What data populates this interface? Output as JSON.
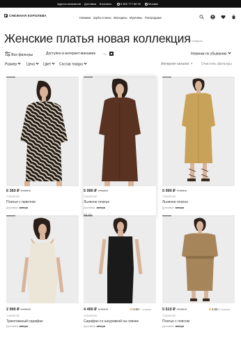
{
  "topbar": {
    "links": [
      "Адреса магазинов",
      "Доставка",
      "Контакты"
    ],
    "phone": "8 800 777 88 99",
    "city": "Москва"
  },
  "header": {
    "logo": "СНЕЖНАЯ КОРОЛЕВА",
    "nav": [
      "Новинки",
      "Шубы и меха",
      "Женщины",
      "Мужчины",
      "Распродажа"
    ],
    "icons": [
      "search-icon",
      "user-icon",
      "heart-icon",
      "cart-icon"
    ]
  },
  "page": {
    "title": "Женские платья новая коллекция",
    "count": "70 товаров"
  },
  "filters": {
    "all_filters": "Все фильтры",
    "online_only": "Доступно в интернет-магазине",
    "online_count": "70",
    "sort": "Новинки по убыванию",
    "size": "Размер",
    "price": "Цена",
    "color": "Цвет",
    "composition": "Состав товара",
    "catalog": "Интернет каталог",
    "clear": "Очистить фильтры"
  },
  "products": [
    {
      "price": "6 360 ₽",
      "old_price": "8 490 ₽",
      "rating": "",
      "reviews": "",
      "brand": "TOM&ROSE",
      "name": "Платье с принтом",
      "delivery_label": "Доставка:",
      "delivery_when": "завтра",
      "sizes": ""
    },
    {
      "price": "5 990 ₽",
      "old_price": "7 990 ₽",
      "rating": "",
      "reviews": "",
      "brand": "TOM&ROSE",
      "name": "Льняное платье",
      "delivery_label": "Доставка:",
      "delivery_when": "завтра",
      "sizes": "XS   XS"
    },
    {
      "price": "5 990 ₽",
      "old_price": "7 990 ₽",
      "rating": "",
      "reviews": "",
      "brand": "TOM&ROSE",
      "name": "Льняное платье",
      "delivery_label": "Доставка:",
      "delivery_when": "завтра",
      "sizes": ""
    },
    {
      "price": "2 990 ₽",
      "old_price": "3 990 ₽",
      "rating": "",
      "reviews": "",
      "brand": "TOM&ROSE",
      "name": "Трикотажный сарафан",
      "delivery_label": "Доставка:",
      "delivery_when": "завтра",
      "sizes": ""
    },
    {
      "price": "4 490 ₽",
      "old_price": "5 990 ₽",
      "rating": "4.80",
      "reviews": "7 отзывов",
      "brand": "TOM&ROSE",
      "name": "Сарафан со шнуровкой на спинке",
      "delivery_label": "Доставка:",
      "delivery_when": "завтра",
      "sizes": ""
    },
    {
      "price": "5 610 ₽",
      "old_price": "7 490 ₽",
      "rating": "4.65",
      "reviews": "6 отзывов",
      "brand": "TOM&ROSE",
      "name": "Платье с поясом",
      "delivery_label": "Доставка:",
      "delivery_when": "завтра",
      "sizes": ""
    }
  ],
  "colors": {
    "topbar": "#111111",
    "bg_photo": "#ececec",
    "zebra_dark": "#1f1a17",
    "zebra_light": "#e9ddc9",
    "brown": "#5a3222",
    "mustard": "#c9a25a",
    "cream": "#ece6d8",
    "black": "#1a1a1a",
    "khaki": "#a6855a",
    "skin": "#d9b49a",
    "hair": "#2a1e18"
  }
}
